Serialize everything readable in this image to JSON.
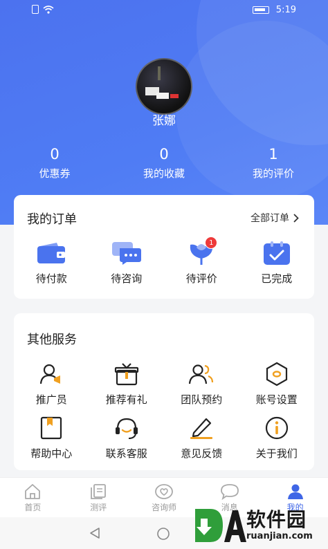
{
  "status_bar": {
    "time": "5:19"
  },
  "profile": {
    "name": "张娜"
  },
  "stats": [
    {
      "value": "0",
      "label": "优惠券"
    },
    {
      "value": "0",
      "label": "我的收藏"
    },
    {
      "value": "1",
      "label": "我的评价"
    }
  ],
  "orders": {
    "title": "我的订单",
    "all_label": "全部订单",
    "items": [
      {
        "label": "待付款",
        "icon": "wallet-icon"
      },
      {
        "label": "待咨询",
        "icon": "chat-bubble-icon"
      },
      {
        "label": "待评价",
        "icon": "flower-icon",
        "badge": "1"
      },
      {
        "label": "已完成",
        "icon": "clipboard-check-icon"
      }
    ]
  },
  "services": {
    "title": "其他服务",
    "items": [
      {
        "label": "推广员",
        "icon": "promoter-icon"
      },
      {
        "label": "推荐有礼",
        "icon": "gift-icon"
      },
      {
        "label": "团队预约",
        "icon": "team-icon"
      },
      {
        "label": "账号设置",
        "icon": "hexagon-settings-icon"
      },
      {
        "label": "帮助中心",
        "icon": "help-book-icon"
      },
      {
        "label": "联系客服",
        "icon": "headset-icon"
      },
      {
        "label": "意见反馈",
        "icon": "pen-icon"
      },
      {
        "label": "关于我们",
        "icon": "info-icon"
      }
    ]
  },
  "tabbar": [
    {
      "label": "首页",
      "icon": "home-icon"
    },
    {
      "label": "测评",
      "icon": "test-icon"
    },
    {
      "label": "咨询师",
      "icon": "heart-icon"
    },
    {
      "label": "消息",
      "icon": "message-icon"
    },
    {
      "label": "我的",
      "icon": "user-icon",
      "active": true
    }
  ],
  "watermark": {
    "text": "软件园",
    "sub": "ruanjian.com"
  },
  "colors": {
    "accent": "#3f66e6",
    "hero": "#4f7cf4",
    "badge": "#ee3a3a",
    "service_icon_accent": "#f0a020"
  }
}
